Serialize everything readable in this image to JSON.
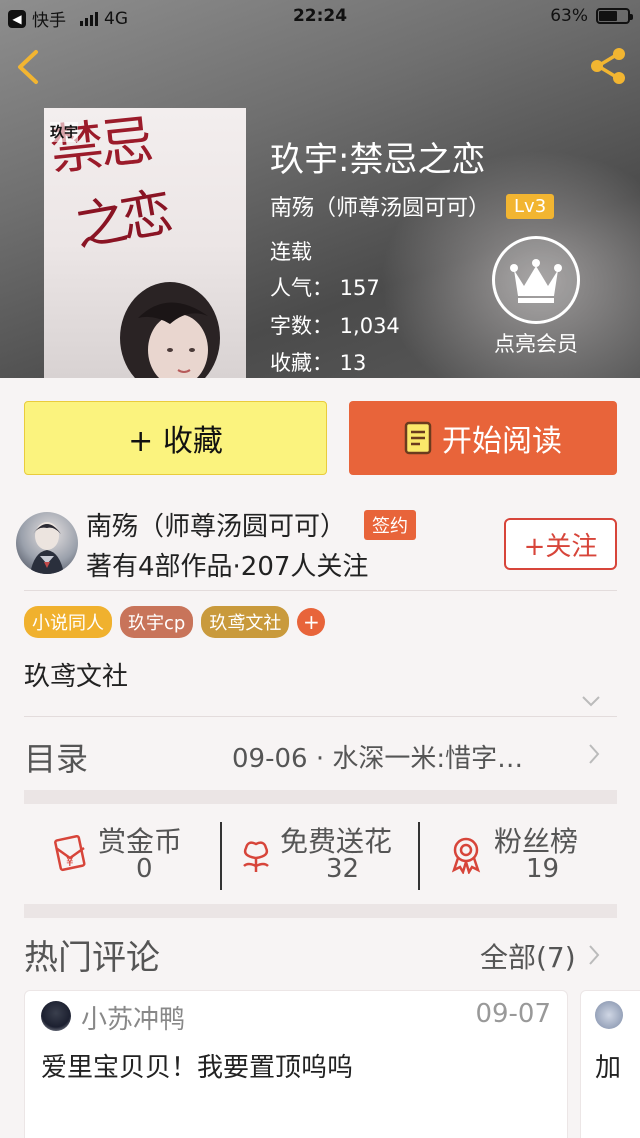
{
  "status_bar": {
    "carrier_app": "快手",
    "network": "4G",
    "time": "22:24",
    "battery": "63%",
    "battery_level": 0.63
  },
  "book": {
    "title": "玖宇:禁忌之恋",
    "author": "南殇（师尊汤圆可可）",
    "level_badge": "Lv3",
    "status": "连载",
    "popularity": "人气：  157",
    "word_count": "字数：  1,034",
    "favorites": "收藏：  13",
    "cover_title_top": "禁忌",
    "cover_title_bottom": "之恋",
    "cover_tag": "玖宇"
  },
  "vip": {
    "label": "点亮会员",
    "icon": "crown-icon"
  },
  "actions": {
    "favorite_label": "+ 收藏",
    "read_label": "开始阅读"
  },
  "author_info": {
    "name": "南殇（师尊汤圆可可）",
    "signed_badge": "签约",
    "stats": "著有4部作品·207人关注",
    "follow_label": "+关注"
  },
  "tags": [
    {
      "label": "小说同人",
      "color": "#f0b12e"
    },
    {
      "label": "玖宇cp",
      "color": "#c8745a"
    },
    {
      "label": "玖鸢文社",
      "color": "#c99a3c"
    }
  ],
  "tag_add_label": "+",
  "intro": "玖鸢文社",
  "toc": {
    "title": "目录",
    "latest": "09-06 · 水深一米:惜字…"
  },
  "stats": [
    {
      "label": "赏金币",
      "value": "0",
      "icon": "red-envelope-icon"
    },
    {
      "label": "免费送花",
      "value": "32",
      "icon": "flower-icon"
    },
    {
      "label": "粉丝榜",
      "value": "19",
      "icon": "medal-icon"
    }
  ],
  "hot_comments": {
    "title": "热门评论",
    "all_label": "全部(7)",
    "items": [
      {
        "user": "小苏冲鸭",
        "date": "09-07",
        "text": "爱里宝贝贝！我要置顶呜呜"
      },
      {
        "text": "加"
      }
    ]
  },
  "colors": {
    "accent": "#e8643a",
    "favorite_button": "#fbf37e",
    "follow": "#d7453a"
  }
}
